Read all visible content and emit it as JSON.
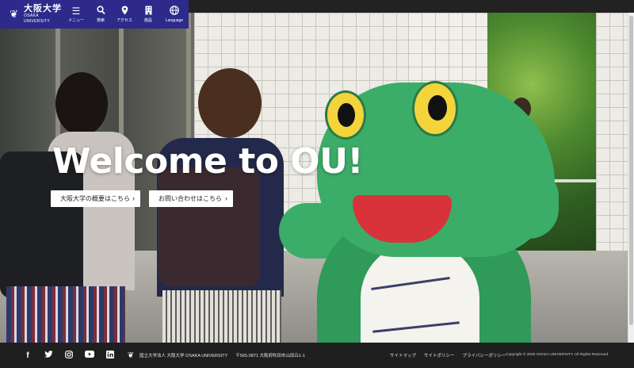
{
  "header": {
    "logo_jp": "大阪大学",
    "logo_en": "OSAKA UNIVERSITY",
    "nav": [
      {
        "icon": "menu-icon",
        "label": "メニュー"
      },
      {
        "icon": "search-icon",
        "label": "検索"
      },
      {
        "icon": "map-pin-icon",
        "label": "アクセス"
      },
      {
        "icon": "building-icon",
        "label": "施設"
      },
      {
        "icon": "globe-icon",
        "label": "Language"
      }
    ]
  },
  "hero": {
    "title": "Welcome to OU!",
    "buttons": [
      {
        "label": "大阪大学の概要はこちら"
      },
      {
        "label": "お問い合わせはこちら"
      }
    ]
  },
  "footer": {
    "social": [
      "facebook-icon",
      "twitter-icon",
      "instagram-icon",
      "youtube-icon",
      "linkedin-icon"
    ],
    "org": "国立大学法人 大阪大学 OSAKA UNIVERSITY",
    "address": "〒565-0871 大阪府吹田市山田丘1-1",
    "links": [
      "サイトマップ",
      "サイトポリシー",
      "プライバシーポリシー"
    ],
    "copyright": "Copyright © 2020 OSAKA UNIVERSITY. All Rights Reserved."
  },
  "colors": {
    "brand": "#2d2a8c",
    "footer_bg": "#1f1f1f",
    "mascot_green": "#3bad68"
  }
}
